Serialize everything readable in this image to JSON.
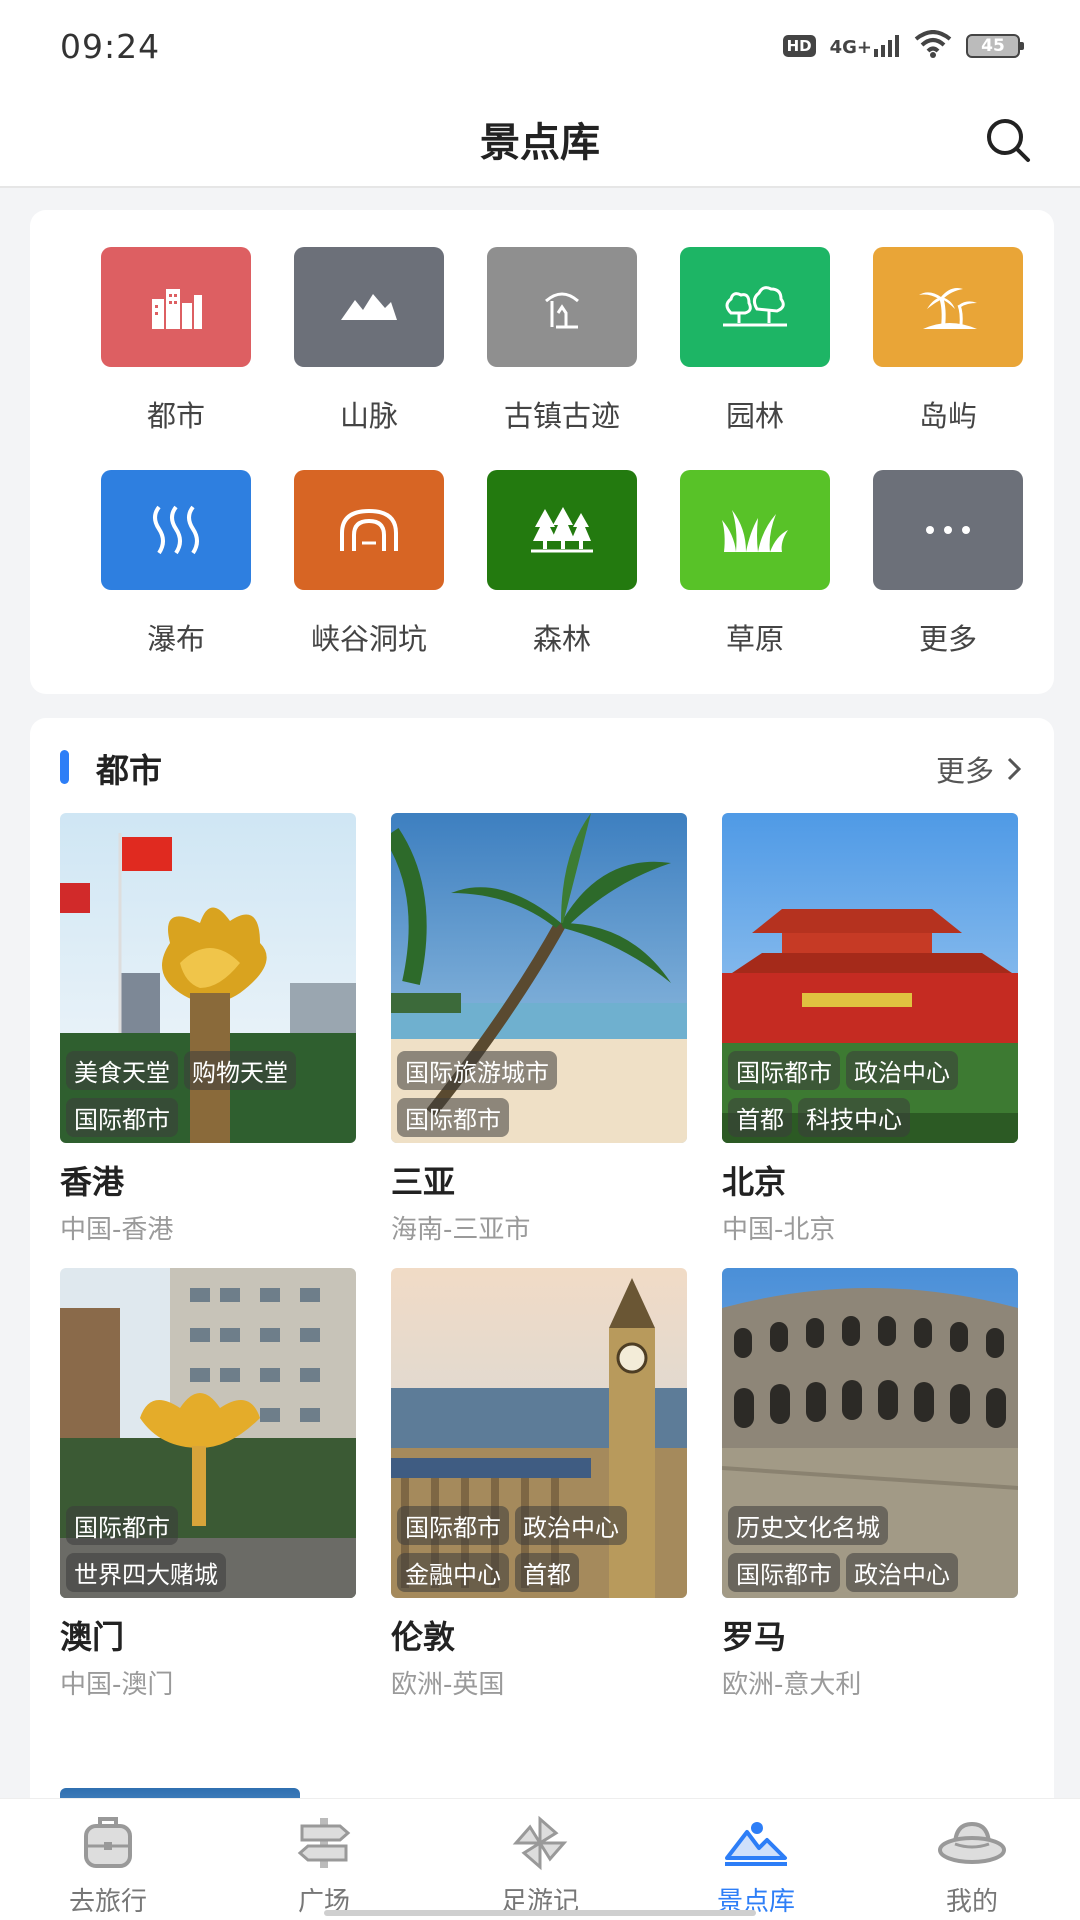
{
  "status": {
    "time": "09:24",
    "hd": "HD",
    "network": "4G+",
    "battery": "45"
  },
  "header": {
    "title": "景点库"
  },
  "categories": [
    {
      "label": "都市",
      "icon": "city-icon",
      "color": "#dd5f62"
    },
    {
      "label": "山脉",
      "icon": "mountain-icon",
      "color": "#6c7079"
    },
    {
      "label": "古镇古迹",
      "icon": "pagoda-icon",
      "color": "#8f8f8f"
    },
    {
      "label": "园林",
      "icon": "garden-icon",
      "color": "#1db565"
    },
    {
      "label": "岛屿",
      "icon": "palm-island-icon",
      "color": "#e9a537"
    },
    {
      "label": "瀑布",
      "icon": "waterfall-icon",
      "color": "#2e7fe0"
    },
    {
      "label": "峡谷洞坑",
      "icon": "canyon-icon",
      "color": "#d76524"
    },
    {
      "label": "森林",
      "icon": "forest-icon",
      "color": "#237a0f"
    },
    {
      "label": "草原",
      "icon": "grassland-icon",
      "color": "#58c228"
    },
    {
      "label": "更多",
      "icon": "more-dots-icon",
      "color": "#6c7079"
    }
  ],
  "section": {
    "title": "都市",
    "more": "更多"
  },
  "cities": [
    {
      "name": "香港",
      "location": "中国-香港",
      "tags": [
        [
          "美食天堂",
          "购物天堂"
        ],
        [
          "国际都市"
        ]
      ]
    },
    {
      "name": "三亚",
      "location": "海南-三亚市",
      "tags": [
        [
          "国际旅游城市"
        ],
        [
          "国际都市"
        ]
      ]
    },
    {
      "name": "北京",
      "location": "中国-北京",
      "tags": [
        [
          "国际都市",
          "政治中心"
        ],
        [
          "首都",
          "科技中心"
        ]
      ]
    },
    {
      "name": "澳门",
      "location": "中国-澳门",
      "tags": [
        [
          "国际都市"
        ],
        [
          "世界四大赌城"
        ]
      ]
    },
    {
      "name": "伦敦",
      "location": "欧洲-英国",
      "tags": [
        [
          "国际都市",
          "政治中心"
        ],
        [
          "金融中心",
          "首都"
        ]
      ]
    },
    {
      "name": "罗马",
      "location": "欧洲-意大利",
      "tags": [
        [
          "历史文化名城"
        ],
        [
          "国际都市",
          "政治中心"
        ]
      ]
    }
  ],
  "nav": [
    {
      "label": "去旅行",
      "icon": "suitcase-icon",
      "active": false
    },
    {
      "label": "广场",
      "icon": "signpost-icon",
      "active": false
    },
    {
      "label": "足游记",
      "icon": "pinwheel-icon",
      "active": false
    },
    {
      "label": "景点库",
      "icon": "landscape-icon",
      "active": true
    },
    {
      "label": "我的",
      "icon": "hat-icon",
      "active": false
    }
  ],
  "accent_color": "#2d7ef7"
}
